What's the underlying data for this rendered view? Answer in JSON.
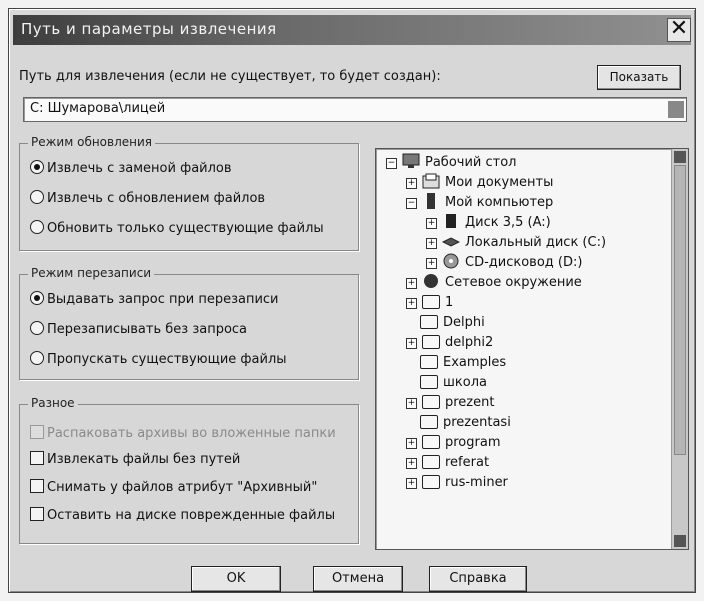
{
  "window": {
    "title": "Путь и параметры извлечения",
    "close_glyph": "✕"
  },
  "path": {
    "label": "Путь для извлечения (если не существует, то будет создан):",
    "show_button": "Показать",
    "value": "C:  Шумарова\\лицей"
  },
  "update_mode": {
    "legend": "Режим обновления",
    "options": [
      {
        "label": "Извлечь с заменой файлов",
        "selected": true
      },
      {
        "label": "Извлечь с обновлением файлов",
        "selected": false
      },
      {
        "label": "Обновить только существующие файлы",
        "selected": false
      }
    ]
  },
  "overwrite_mode": {
    "legend": "Режим перезаписи",
    "options": [
      {
        "label": "Выдавать запрос при перезаписи",
        "selected": true
      },
      {
        "label": "Перезаписывать без запроса",
        "selected": false
      },
      {
        "label": "Пропускать существующие файлы",
        "selected": false
      }
    ]
  },
  "misc": {
    "legend": "Разное",
    "options": [
      {
        "label": "Распаковать архивы во вложенные папки",
        "checked": false,
        "disabled": true
      },
      {
        "label": "Извлекать файлы без путей",
        "checked": false,
        "disabled": false
      },
      {
        "label": "Снимать у файлов атрибут \"Архивный\"",
        "checked": false,
        "disabled": false
      },
      {
        "label": "Оставить на диске поврежденные файлы",
        "checked": false,
        "disabled": false
      }
    ]
  },
  "tree": {
    "items": [
      {
        "label": "Рабочий стол",
        "expander": "−",
        "icon": "desktop-icon"
      },
      {
        "label": "Мои документы",
        "expander": "+",
        "icon": "documents-icon"
      },
      {
        "label": "Мой компьютер",
        "expander": "−",
        "icon": "computer-icon"
      },
      {
        "label": "Диск 3,5 (A:)",
        "expander": "+",
        "icon": "floppy-icon"
      },
      {
        "label": "Локальный диск (C:)",
        "expander": "+",
        "icon": "harddisk-icon"
      },
      {
        "label": "CD-дисковод (D:)",
        "expander": "+",
        "icon": "cdrom-icon"
      },
      {
        "label": "Сетевое окружение",
        "expander": "+",
        "icon": "network-icon"
      },
      {
        "label": "1",
        "expander": "+",
        "icon": "folder-icon"
      },
      {
        "label": "Delphi",
        "expander": "",
        "icon": "folder-icon"
      },
      {
        "label": "delphi2",
        "expander": "+",
        "icon": "folder-icon"
      },
      {
        "label": "Examples",
        "expander": "",
        "icon": "folder-icon"
      },
      {
        "label": "школа",
        "expander": "",
        "icon": "folder-icon"
      },
      {
        "label": "prezent",
        "expander": "+",
        "icon": "folder-icon"
      },
      {
        "label": "prezentasi",
        "expander": "",
        "icon": "folder-icon"
      },
      {
        "label": "program",
        "expander": "+",
        "icon": "folder-icon"
      },
      {
        "label": "referat",
        "expander": "+",
        "icon": "folder-icon"
      },
      {
        "label": "rus-miner",
        "expander": "+",
        "icon": "folder-icon"
      }
    ]
  },
  "buttons": {
    "ok": "OK",
    "cancel": "Отмена",
    "help": "Справка"
  }
}
